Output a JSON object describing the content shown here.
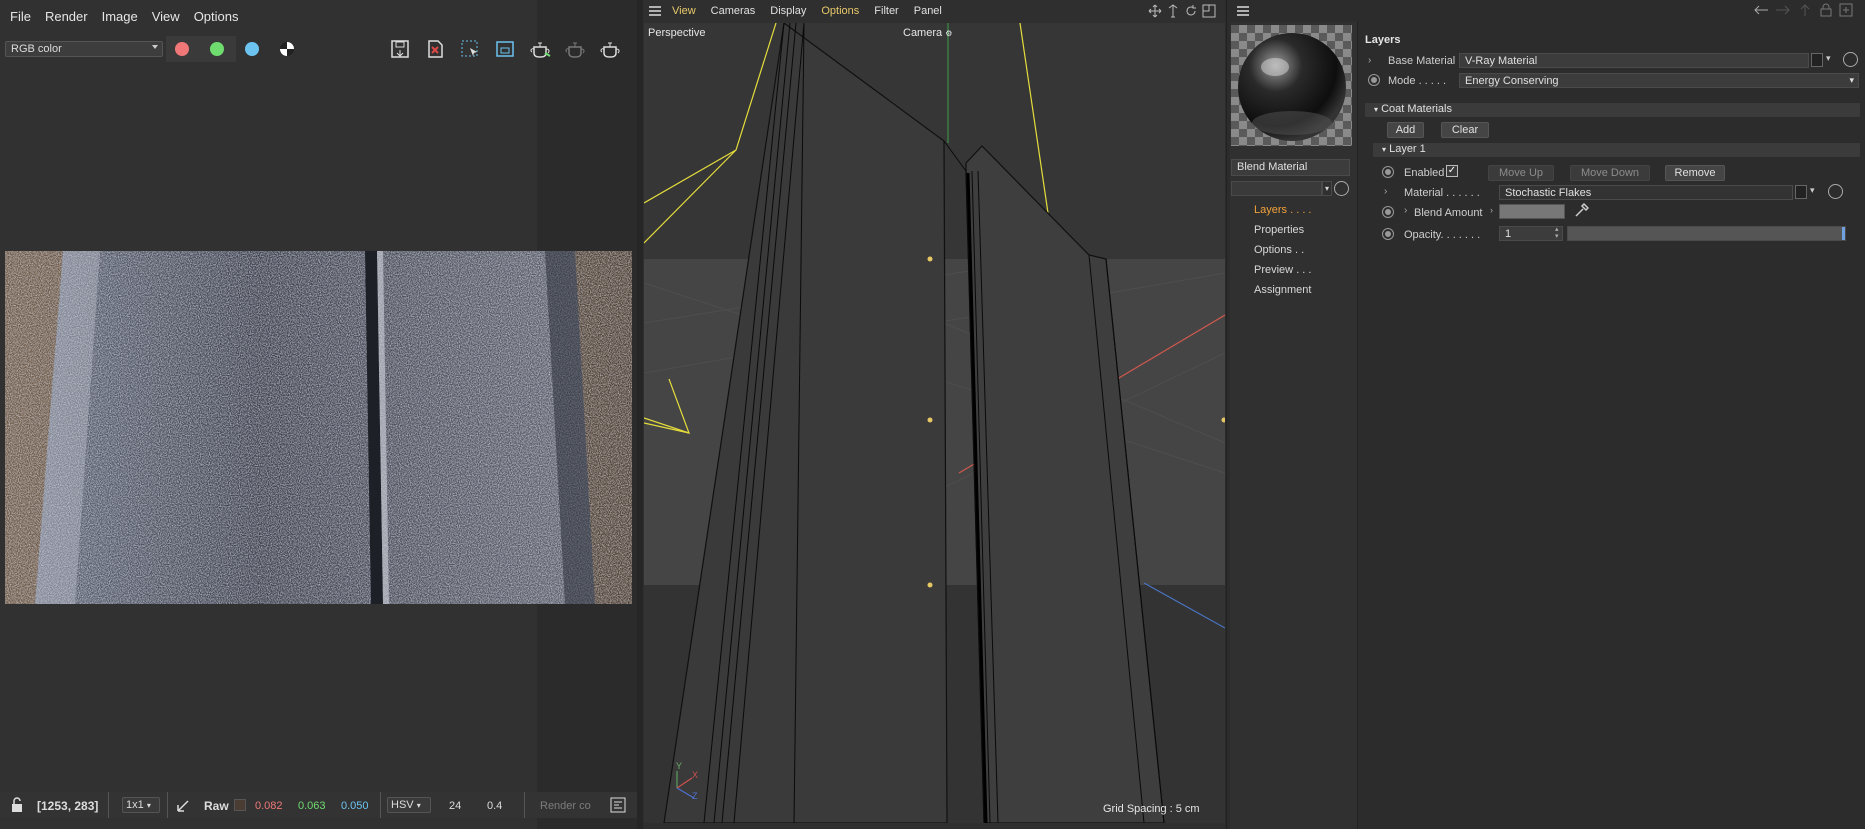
{
  "vfb": {
    "menu": [
      "File",
      "Render",
      "Image",
      "View",
      "Options"
    ],
    "channel_select": "RGB color",
    "status": {
      "coords": "[1253, 283]",
      "zoom_select": "1x1",
      "raw_label": "Raw",
      "r": "0.082",
      "g": "0.063",
      "b": "0.050",
      "color_mode": "HSV",
      "val1": "24",
      "val2": "0.4",
      "render_co": "Render co"
    }
  },
  "viewport": {
    "menu": [
      "View",
      "Cameras",
      "Display",
      "Options",
      "Filter",
      "Panel"
    ],
    "label_perspective": "Perspective",
    "label_camera": "Camera",
    "grid_spacing": "Grid Spacing : 5 cm",
    "axis": {
      "x": "X",
      "y": "Y",
      "z": "Z"
    }
  },
  "material_editor": {
    "material_name": "Blend Material",
    "nav": [
      "Layers",
      "Properties",
      "Options",
      "Preview",
      "Assignment"
    ],
    "nav_dots": [
      ". . . .",
      "",
      ". .",
      ". . .",
      ""
    ],
    "section_title": "Layers",
    "base_material_label": "Base Material",
    "base_material_value": "V-Ray Material",
    "mode_label": "Mode . . . . .",
    "mode_value": "Energy Conserving",
    "coat_header": "Coat Materials",
    "add_label": "Add",
    "clear_label": "Clear",
    "layer_header": "Layer 1",
    "enabled_label": "Enabled",
    "move_up": "Move Up",
    "move_down": "Move Down",
    "remove": "Remove",
    "material_label": "Material . . . . . .",
    "material_value": "Stochastic Flakes",
    "blend_amount_label": "Blend Amount",
    "opacity_label": "Opacity. . . . . . .",
    "opacity_value": "1"
  },
  "colors": {
    "accent": "#e8c96a",
    "red_channel": "#ef7777",
    "green_channel": "#6fdc6f",
    "blue_channel": "#6cc3f0",
    "nav_active": "#f2a13b"
  }
}
